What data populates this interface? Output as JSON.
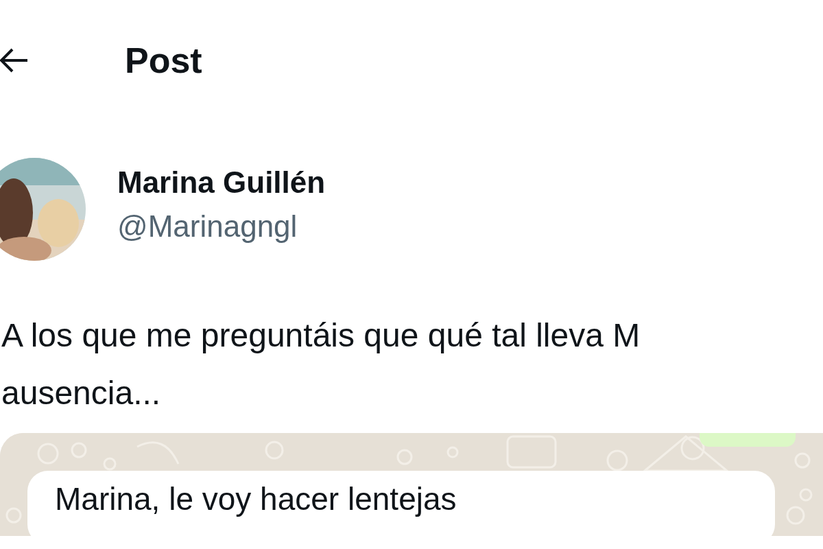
{
  "header": {
    "title": "Post"
  },
  "author": {
    "name": "Marina Guillén",
    "handle": "@Marinagngl"
  },
  "tweet": {
    "lines": [
      "A los que me preguntáis que qué tal lleva M",
      "ausencia..."
    ]
  },
  "attachment": {
    "kind": "chat",
    "messages": [
      {
        "text": "Marina, le voy hacer lentejas",
        "sent": false
      }
    ]
  }
}
